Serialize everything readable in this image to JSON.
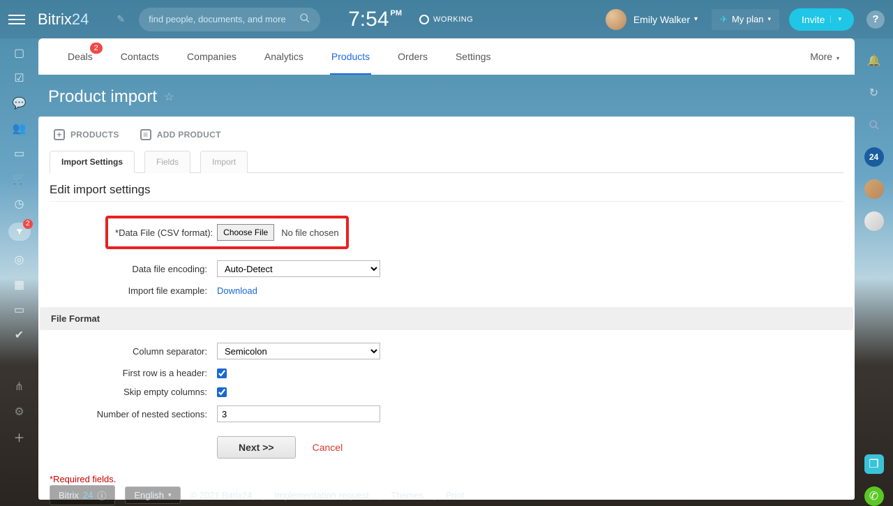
{
  "header": {
    "logo_a": "Bitrix",
    "logo_b": "24",
    "search_placeholder": "find people, documents, and more",
    "clock_time": "7:54",
    "clock_pm": "PM",
    "working_label": "WORKING",
    "username": "Emily Walker",
    "myplan": "My plan",
    "invite": "Invite"
  },
  "tabs": {
    "deals": "Deals",
    "deals_badge": "2",
    "contacts": "Contacts",
    "companies": "Companies",
    "analytics": "Analytics",
    "products": "Products",
    "orders": "Orders",
    "settings": "Settings",
    "more": "More"
  },
  "page": {
    "title": "Product import"
  },
  "toolbar": {
    "products": "PRODUCTS",
    "add_product": "ADD PRODUCT"
  },
  "inner_tabs": {
    "import_settings": "Import Settings",
    "fields": "Fields",
    "import": "Import"
  },
  "section": {
    "h2": "Edit import settings",
    "file_format": "File Format"
  },
  "form": {
    "data_file_label": "Data File (CSV format):",
    "choose_file": "Choose File",
    "no_file": "No file chosen",
    "encoding_label": "Data file encoding:",
    "encoding_value": "Auto-Detect",
    "example_label": "Import file example:",
    "download": "Download",
    "col_sep_label": "Column separator:",
    "col_sep_value": "Semicolon",
    "first_row_label": "First row is a header:",
    "skip_empty_label": "Skip empty columns:",
    "nested_label": "Number of nested sections:",
    "nested_value": "3",
    "next": "Next >>",
    "cancel": "Cancel"
  },
  "notes": {
    "required": "*Required fields."
  },
  "left_sidebar": {
    "filter_badge": "2"
  },
  "right_sidebar": {
    "b24": "24"
  },
  "footer": {
    "bitrix": "Bitrix",
    "b24sym": "24",
    "lang": "English",
    "copy": "© 2021 Bitrix24",
    "impl": "Implementation request",
    "themes": "Themes",
    "print": "Print"
  }
}
